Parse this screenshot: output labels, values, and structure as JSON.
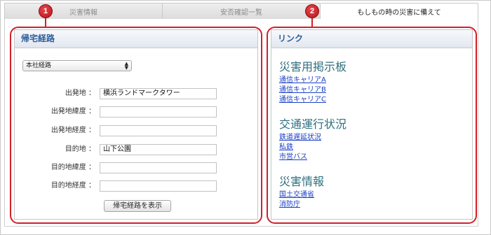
{
  "tabs": [
    {
      "label": "災害情報",
      "active": false
    },
    {
      "label": "安否確認一覧",
      "active": false
    },
    {
      "label": "もしもの時の災害に備えて",
      "active": true
    }
  ],
  "callouts": [
    "1",
    "2"
  ],
  "left_panel": {
    "title": "帰宅経路",
    "route_select": {
      "value": "本社経路"
    },
    "fields": [
      {
        "label": "出発地 ：",
        "value": "横浜ランドマークタワー"
      },
      {
        "label": "出発地緯度 ：",
        "value": ""
      },
      {
        "label": "出発地経度 ：",
        "value": ""
      },
      {
        "label": "目的地 ：",
        "value": "山下公園"
      },
      {
        "label": "目的地緯度 ：",
        "value": ""
      },
      {
        "label": "目的地経度 ：",
        "value": ""
      }
    ],
    "show_button": "帰宅経路を表示"
  },
  "right_panel": {
    "title": "リンク",
    "sections": [
      {
        "title": "災害用掲示板",
        "links": [
          "通信キャリアA",
          "通信キャリアB",
          "通信キャリアC"
        ]
      },
      {
        "title": "交通運行状況",
        "links": [
          "鉄道遅延状況",
          "私鉄",
          "市営バス"
        ]
      },
      {
        "title": "災害情報",
        "links": [
          "国土交通省",
          "消防庁"
        ]
      }
    ]
  },
  "colors": {
    "annotation_red": "#d0202a",
    "header_text": "#2f5d99",
    "section_title": "#2f6f7f",
    "link": "#1a3fc4"
  }
}
